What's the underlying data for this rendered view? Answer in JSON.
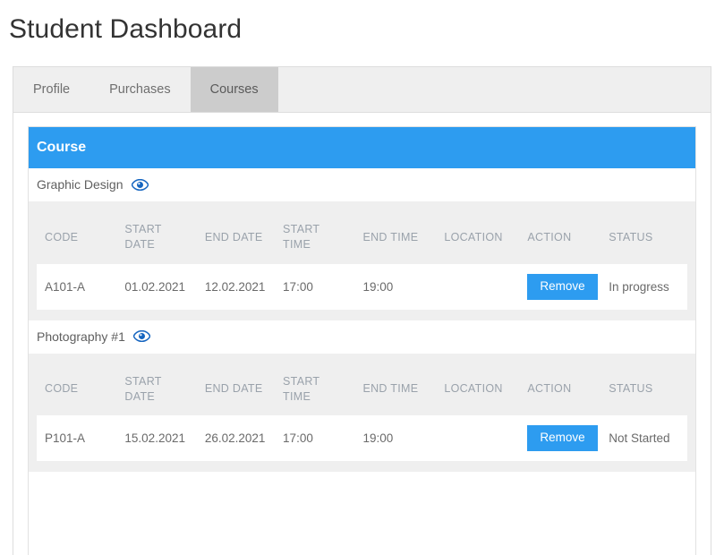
{
  "header": {
    "title": "Student Dashboard"
  },
  "tabs": [
    {
      "label": "Profile",
      "active": false
    },
    {
      "label": "Purchases",
      "active": false
    },
    {
      "label": "Courses",
      "active": true
    }
  ],
  "panel": {
    "heading": "Course",
    "accent_color": "#2d9cf0",
    "header_text_color": "#ffffff"
  },
  "icons": {
    "eye": "eye-icon",
    "eye_color": "#1565c0"
  },
  "table": {
    "columns": [
      "CODE",
      "START DATE",
      "END DATE",
      "START TIME",
      "END TIME",
      "LOCATION",
      "ACTION",
      "STATUS"
    ]
  },
  "courses": [
    {
      "name": "Graphic Design",
      "rows": [
        {
          "code": "A101-A",
          "start_date": "01.02.2021",
          "end_date": "12.02.2021",
          "start_time": "17:00",
          "end_time": "19:00",
          "location": "",
          "action_label": "Remove",
          "status": "In progress"
        }
      ]
    },
    {
      "name": "Photography #1",
      "rows": [
        {
          "code": "P101-A",
          "start_date": "15.02.2021",
          "end_date": "26.02.2021",
          "start_time": "17:00",
          "end_time": "19:00",
          "location": "",
          "action_label": "Remove",
          "status": "Not Started"
        }
      ]
    }
  ]
}
